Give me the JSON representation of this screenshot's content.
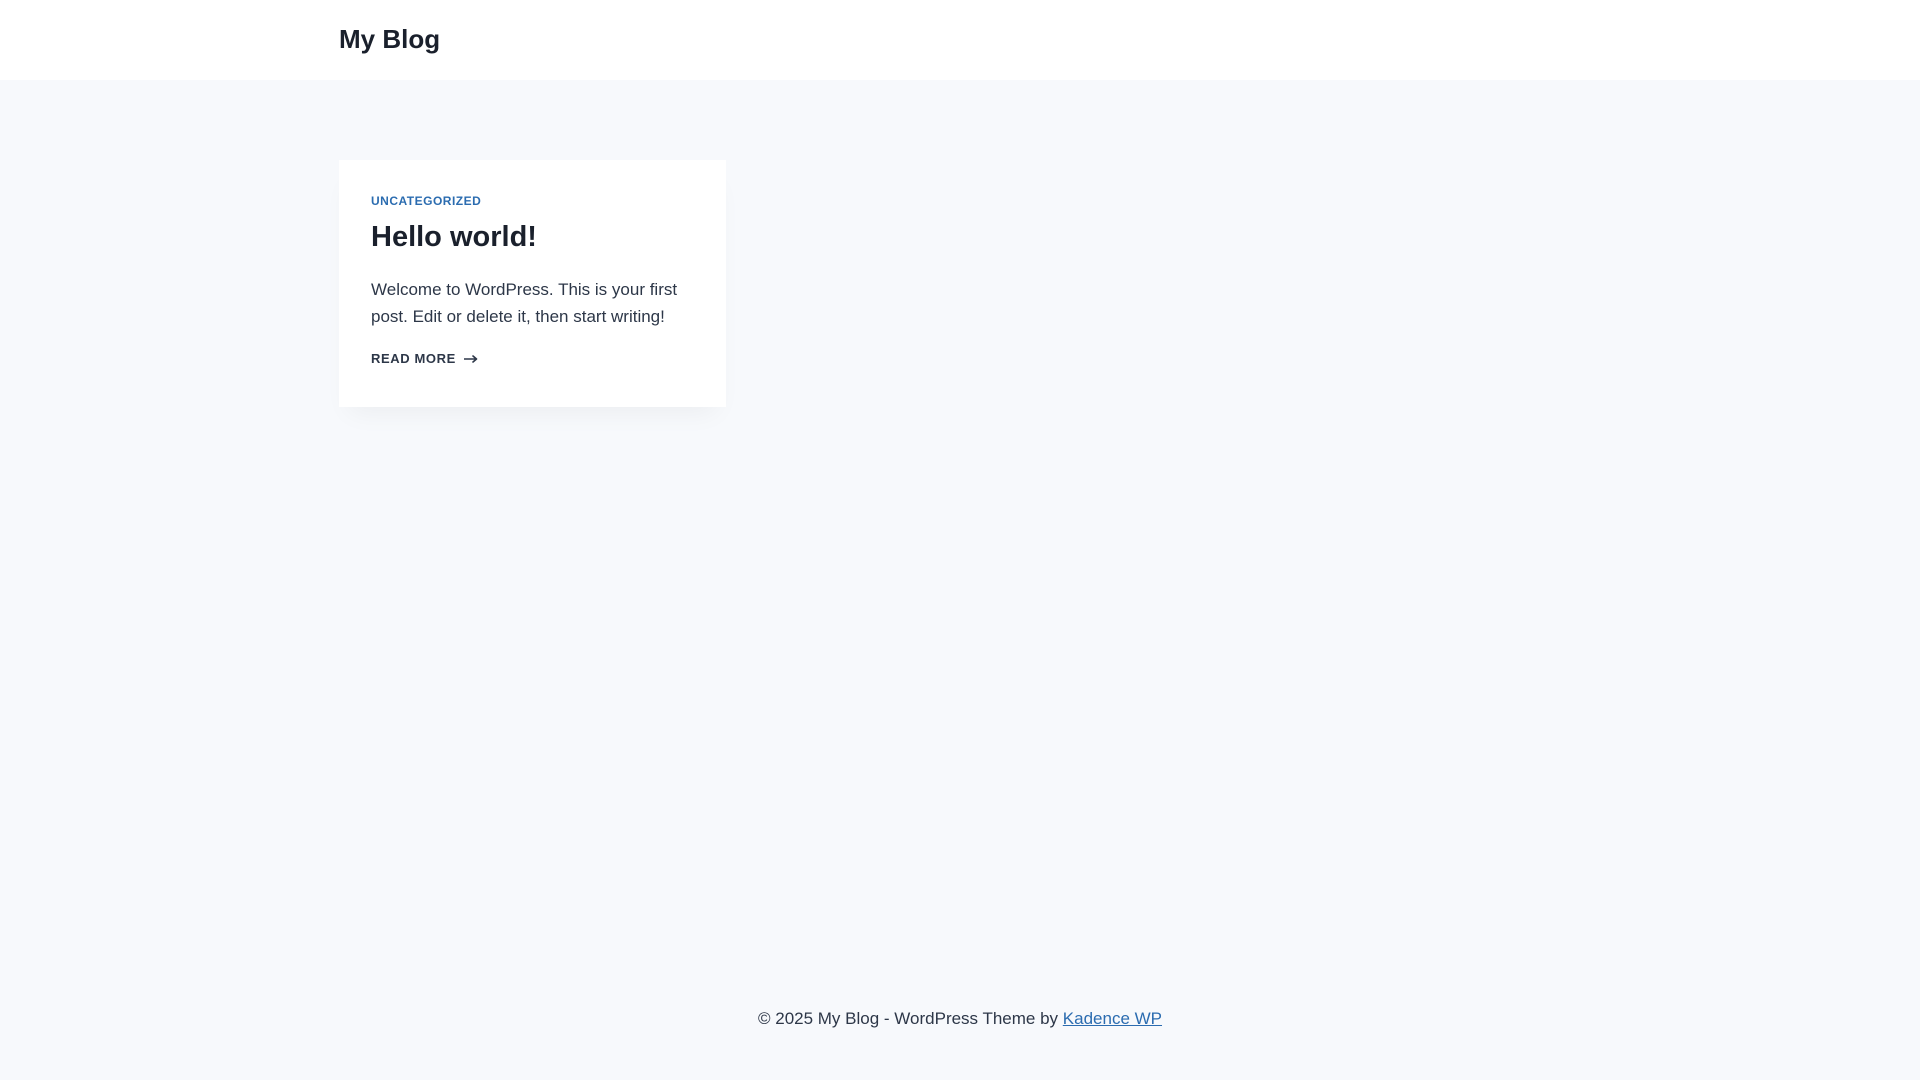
{
  "header": {
    "site_title": "My Blog"
  },
  "post": {
    "category": "UNCATEGORIZED",
    "title": "Hello world!",
    "excerpt": "Welcome to WordPress. This is your first post. Edit or delete it, then start writing!",
    "read_more": "READ MORE",
    "read_more_icon": "arrow-right-icon"
  },
  "footer": {
    "copyright": "© 2025 My Blog - WordPress Theme by ",
    "theme_link": "Kadence WP"
  },
  "colors": {
    "background": "#f7f9fc",
    "card": "#ffffff",
    "accent": "#2b6cb0",
    "heading": "#1a202c",
    "text": "#2d3748"
  }
}
